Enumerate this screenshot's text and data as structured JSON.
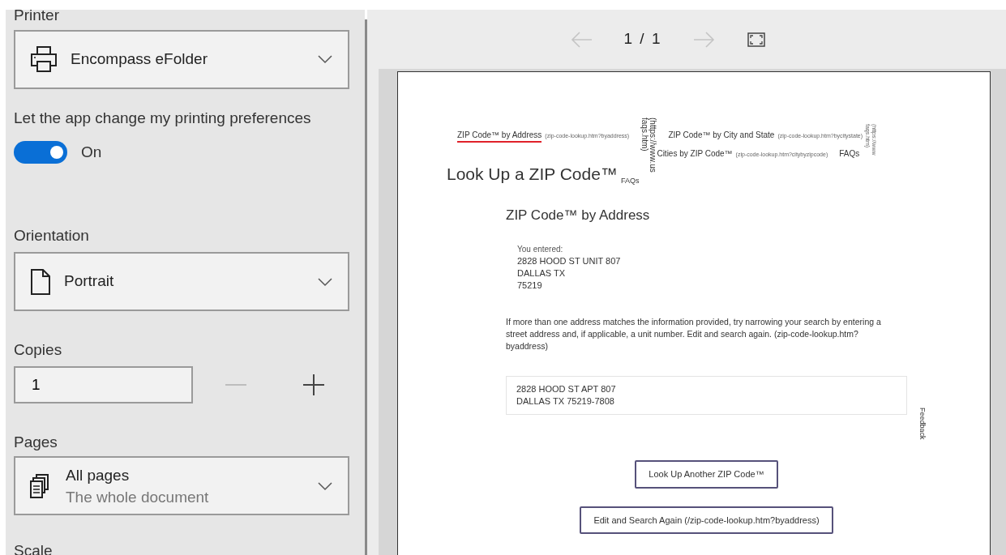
{
  "settings": {
    "printer": {
      "label": "Printer",
      "value": "Encompass eFolder"
    },
    "app_preferences": {
      "label": "Let the app change my printing preferences",
      "on": true,
      "state_text": "On"
    },
    "orientation": {
      "label": "Orientation",
      "value": "Portrait"
    },
    "copies": {
      "label": "Copies",
      "value": "1",
      "decrement_disabled": true,
      "increment_disabled": false
    },
    "pages": {
      "label": "Pages",
      "value": "All pages",
      "description": "The whole document"
    },
    "scale": {
      "label": "Scale"
    }
  },
  "preview": {
    "pager": "1 / 1",
    "previous_disabled": true,
    "next_disabled": true,
    "document": {
      "nav_links": [
        {
          "text": "ZIP Code™ by Address",
          "link": "(zip-code-lookup.htm?byaddress)",
          "selected": true
        },
        {
          "text": "ZIP Code™ by City and State",
          "link": "(zip-code-lookup.htm?bycitystate)",
          "selected": false
        },
        {
          "text": "Cities by ZIP Code™",
          "link": "(zip-code-lookup.htm?citybyzipcode)",
          "selected": false
        },
        {
          "text": "FAQs",
          "selected": false
        }
      ],
      "vertical_link": [
        "(https://www.us",
        "faqs.htm)"
      ],
      "side_vertical_link": [
        "(https://www",
        "faqs.htm)"
      ],
      "title": "Look Up a ZIP Code™",
      "title_link": "FAQs",
      "heading": "ZIP Code™ by Address",
      "entered_label": "You entered:",
      "entered_lines": [
        "2828 HOOD ST UNIT 807",
        "DALLAS TX",
        "75219"
      ],
      "notice": "If more than one address matches the information provided, try narrowing your search by entering a street address and, if applicable, a unit number. Edit and search again. (zip-code-lookup.htm?byaddress)",
      "result_lines": [
        "2828 HOOD ST APT 807",
        "DALLAS TX 75219-7808"
      ],
      "feedback": "Feedback",
      "buttons": [
        "Look Up Another ZIP Code™",
        "Edit and Search Again (/zip-code-lookup.htm?byaddress)"
      ]
    }
  }
}
